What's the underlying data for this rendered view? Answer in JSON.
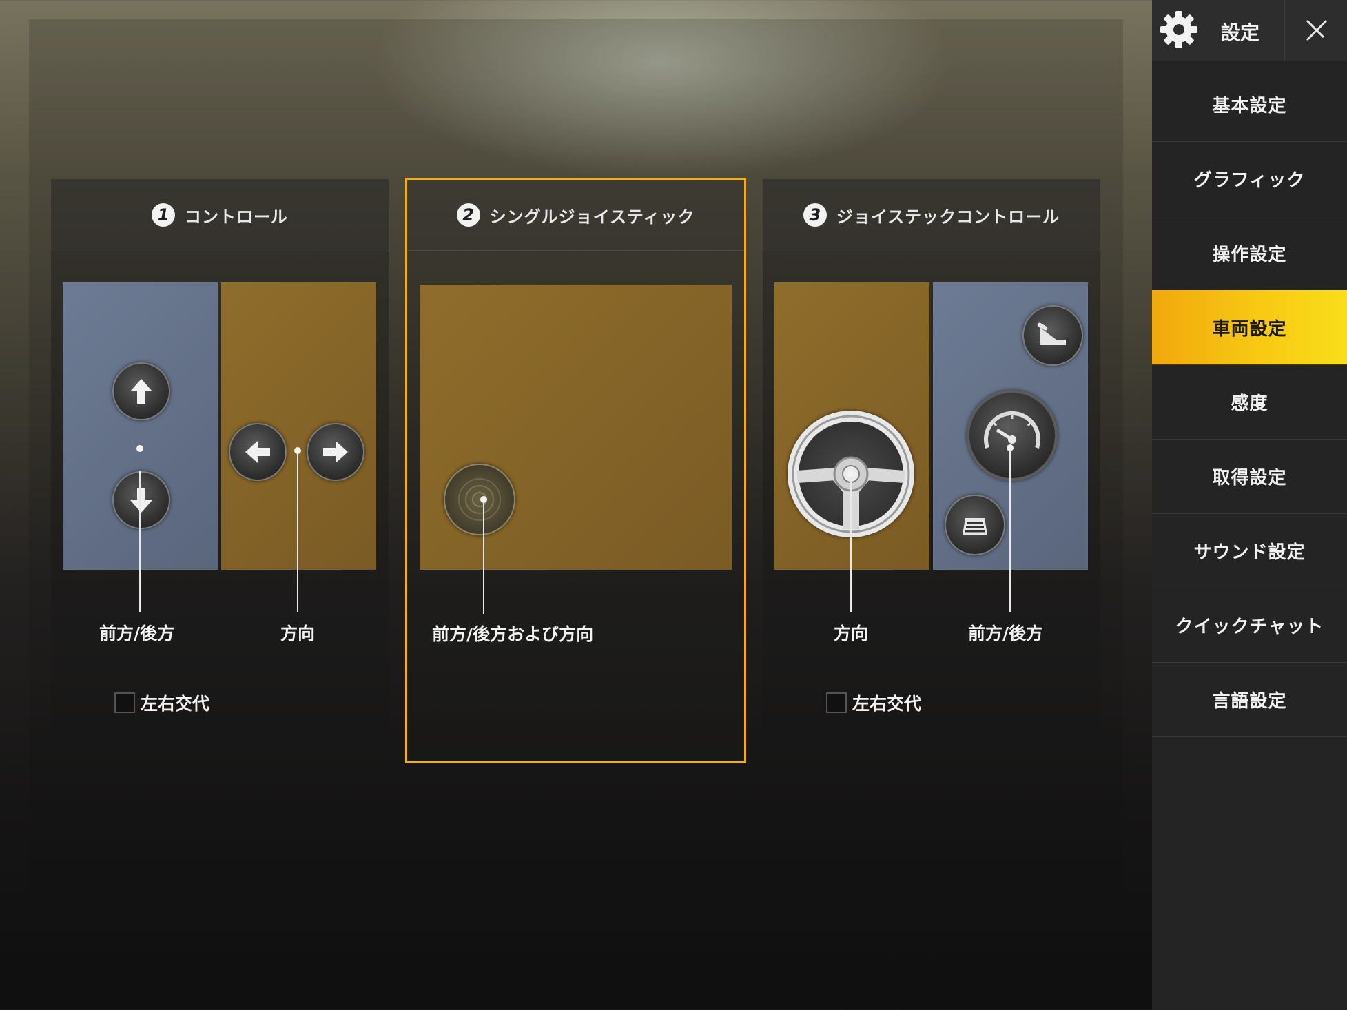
{
  "sidebar": {
    "title": "設定",
    "items": [
      {
        "label": "基本設定"
      },
      {
        "label": "グラフィック"
      },
      {
        "label": "操作設定"
      },
      {
        "label": "車両設定",
        "active": true
      },
      {
        "label": "感度"
      },
      {
        "label": "取得設定"
      },
      {
        "label": "サウンド設定"
      },
      {
        "label": "クイックチャット"
      },
      {
        "label": "言語設定"
      }
    ]
  },
  "cards": [
    {
      "number": "1",
      "title": "コントロール",
      "labels": [
        "前方/後方",
        "方向"
      ],
      "checkbox_label": "左右交代",
      "checked": false,
      "selected": false
    },
    {
      "number": "2",
      "title": "シングルジョイスティック",
      "labels": [
        "前方/後方および方向"
      ],
      "selected": true
    },
    {
      "number": "3",
      "title": "ジョイステックコントロール",
      "labels": [
        "方向",
        "前方/後方"
      ],
      "checkbox_label": "左右交代",
      "checked": false,
      "selected": false
    }
  ],
  "colors": {
    "accent": "#f0ad1c",
    "zone_blue": "#6d7b94",
    "zone_gold": "#8f6d2c"
  },
  "icons": {
    "gear": "gear-icon",
    "close": "close-icon",
    "up": "arrow-up-icon",
    "down": "arrow-down-icon",
    "left": "arrow-left-icon",
    "right": "arrow-right-icon",
    "wheel": "steering-wheel-icon",
    "speedometer": "speedometer-icon",
    "handbrake": "handbrake-icon",
    "brake": "brake-pedal-icon",
    "joystick": "joystick-icon"
  }
}
